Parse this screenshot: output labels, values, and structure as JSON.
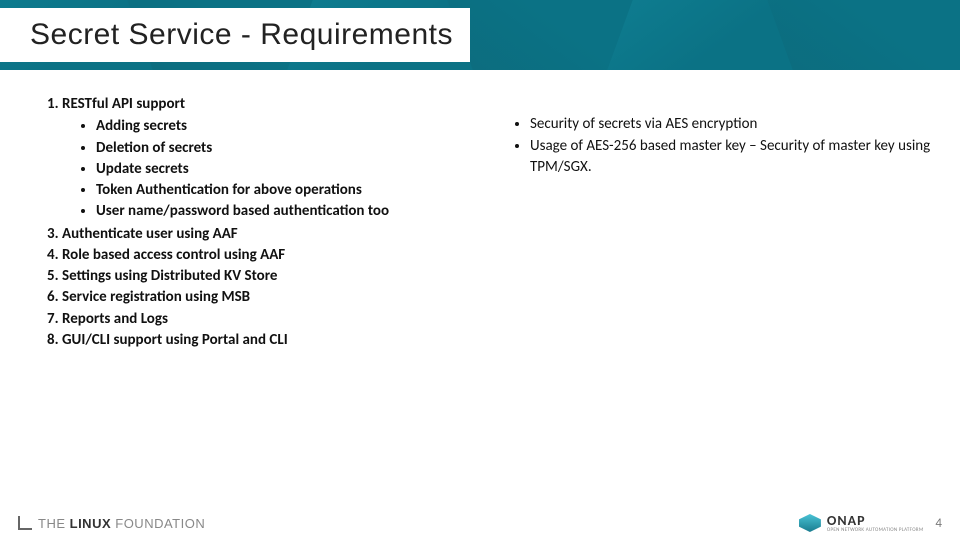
{
  "header": {
    "title": "Secret Service -  Requirements"
  },
  "left": {
    "item1": {
      "label": "RESTful API support",
      "sub": {
        "a": "Adding secrets",
        "b": "Deletion of secrets",
        "c": "Update secrets",
        "d": "Token Authentication for above operations",
        "e": "User name/password based authentication too"
      }
    },
    "item3": "Authenticate user using AAF",
    "item4": "Role based access control using AAF",
    "item5": "Settings using Distributed KV Store",
    "item6": "Service registration using MSB",
    "item7": "Reports and Logs",
    "item8": "GUI/CLI support using Portal and CLI"
  },
  "right": {
    "b1": "Security of secrets via AES encryption",
    "b2": "Usage of AES-256 based master key – Security of master key using TPM/SGX."
  },
  "footer": {
    "lf_the": "THE",
    "lf_name": "LINUX",
    "lf_suffix": "FOUNDATION",
    "onap_name": "ONAP",
    "onap_sub": "OPEN NETWORK AUTOMATION PLATFORM",
    "page": "4"
  }
}
